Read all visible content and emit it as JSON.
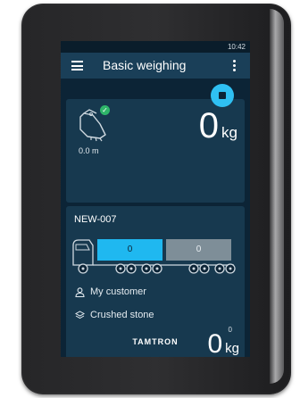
{
  "status_bar": {
    "time": "10:42"
  },
  "app_bar": {
    "title": "Basic weighing",
    "menu_icon": "hamburger-menu-icon",
    "overflow_icon": "more-vert-icon"
  },
  "bucket_card": {
    "bucket_icon": "excavator-bucket-icon",
    "status_icon": "check-circle-icon",
    "bucket_reading": "0.0 m",
    "weight": {
      "value": "0",
      "unit": "kg"
    },
    "stop_icon": "stop-icon"
  },
  "vehicle_card": {
    "vehicle_id": "NEW-007",
    "compartments": [
      "0",
      "0"
    ],
    "customer": {
      "icon": "person-icon",
      "label": "My customer"
    },
    "material": {
      "icon": "layers-icon",
      "label": "Crushed stone"
    },
    "weight": {
      "value": "0",
      "unit": "kg"
    },
    "trip_count": "0"
  },
  "footer": {
    "brand": "TAMTRON"
  },
  "colors": {
    "screen_bg": "#0c2436",
    "card_bg": "#17394f",
    "app_bar": "#1a3f58",
    "accent": "#2fc0f3",
    "ok": "#2fb56a",
    "compartment_active": "#1fb8f0",
    "compartment_inactive": "#7e8e98"
  }
}
